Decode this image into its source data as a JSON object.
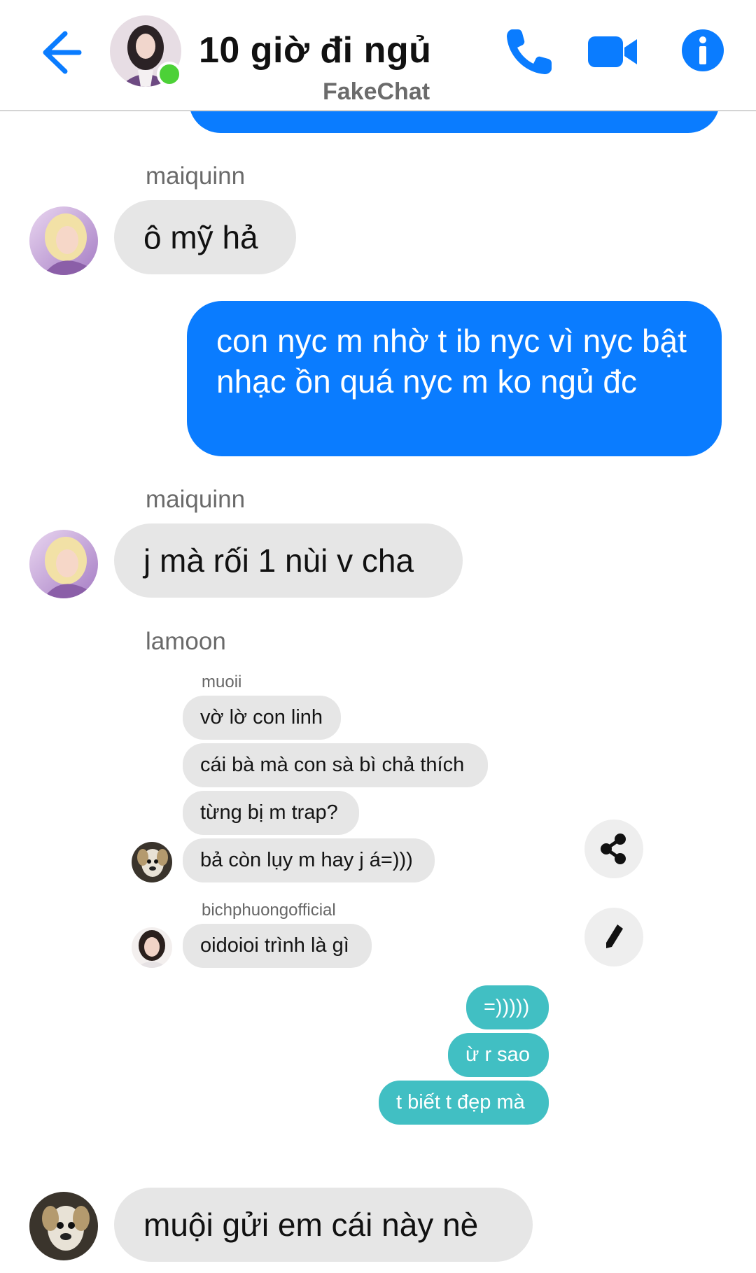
{
  "header": {
    "title": "10 giờ đi ngủ",
    "watermark": "FakeChat",
    "icons": {
      "back": "back-arrow-icon",
      "call": "phone-icon",
      "video": "video-camera-icon",
      "info": "info-icon"
    },
    "online": true
  },
  "colors": {
    "accent": "#0a7cff",
    "incoming_bubble": "#e6e6e6",
    "shared_outgoing_bubble": "#41bfc3",
    "online": "#4cd137"
  },
  "messages": {
    "m1": {
      "sender": "maiquinn",
      "text": "ô mỹ hả"
    },
    "m2": {
      "text": "con nyc m nhờ t ib nyc vì nyc bật nhạc ồn quá nyc m ko ngủ đc"
    },
    "m3": {
      "sender": "maiquinn",
      "text": "j mà rối 1 nùi v cha"
    },
    "m4": {
      "sender": "lamoon"
    },
    "m5": {
      "text": "muội gửi em cái này nè"
    }
  },
  "shared": {
    "group1": {
      "sender": "muoii",
      "lines": [
        "vờ lờ con linh",
        "cái bà mà con sà bì chả thích",
        "từng bị m trap?",
        "bả còn lụy m hay j á=)))"
      ]
    },
    "group2": {
      "sender": "bichphuongofficial",
      "lines": [
        "oidoioi trình là gì"
      ]
    },
    "outgoing": [
      "=)))))",
      "ừ r sao",
      "t biết t đẹp mà"
    ]
  },
  "actions": {
    "share_icon": "share-icon",
    "edit_icon": "pencil-icon"
  }
}
